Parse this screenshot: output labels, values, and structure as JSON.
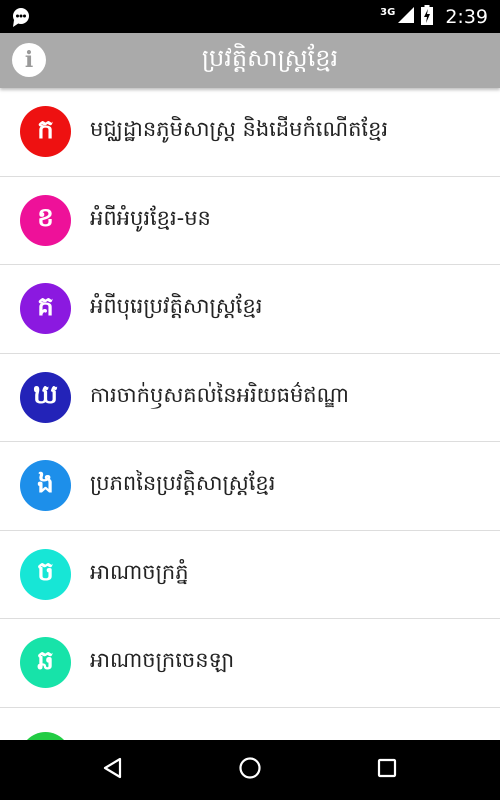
{
  "status_bar": {
    "left_icon": "chat-bubble-icon",
    "network_type": "3G",
    "signal_icon": "signal-icon",
    "battery_icon": "battery-charging-icon",
    "time": "2:39"
  },
  "app_bar": {
    "info_label": "i",
    "title": "ប្រវត្តិសាស្ត្រខ្មែរ"
  },
  "list": {
    "items": [
      {
        "badge": "ក",
        "label": "មជ្ឈដ្ឋានភូមិសាស្ត្រ និងដើមកំណើតខ្មែរ",
        "color": "#ee1111"
      },
      {
        "badge": "ខ",
        "label": "អំពីអំបូរខ្មែរ-មន",
        "color": "#ee1199"
      },
      {
        "badge": "គ",
        "label": "អំពីបុរេប្រវត្តិសាស្ត្រខ្មែរ",
        "color": "#8b19e0"
      },
      {
        "badge": "ឃ",
        "label": "ការចាក់ឫសគល់នៃអរិយធម៌ឥណ្ឌា",
        "color": "#2323b8"
      },
      {
        "badge": "ង",
        "label": "ប្រភពនៃប្រវត្តិសាស្ត្រខ្មែរ",
        "color": "#1d8fea"
      },
      {
        "badge": "ច",
        "label": "អាណាចក្រភ្នំ",
        "color": "#17e6d6"
      },
      {
        "badge": "ឆ",
        "label": "អាណាចក្រចេនឡា",
        "color": "#17e3a9"
      },
      {
        "badge": "",
        "label": "",
        "color": "#22cc44"
      }
    ]
  },
  "nav_bar": {
    "back_icon": "back-triangle-icon",
    "home_icon": "home-circle-icon",
    "recents_icon": "recents-square-icon"
  }
}
